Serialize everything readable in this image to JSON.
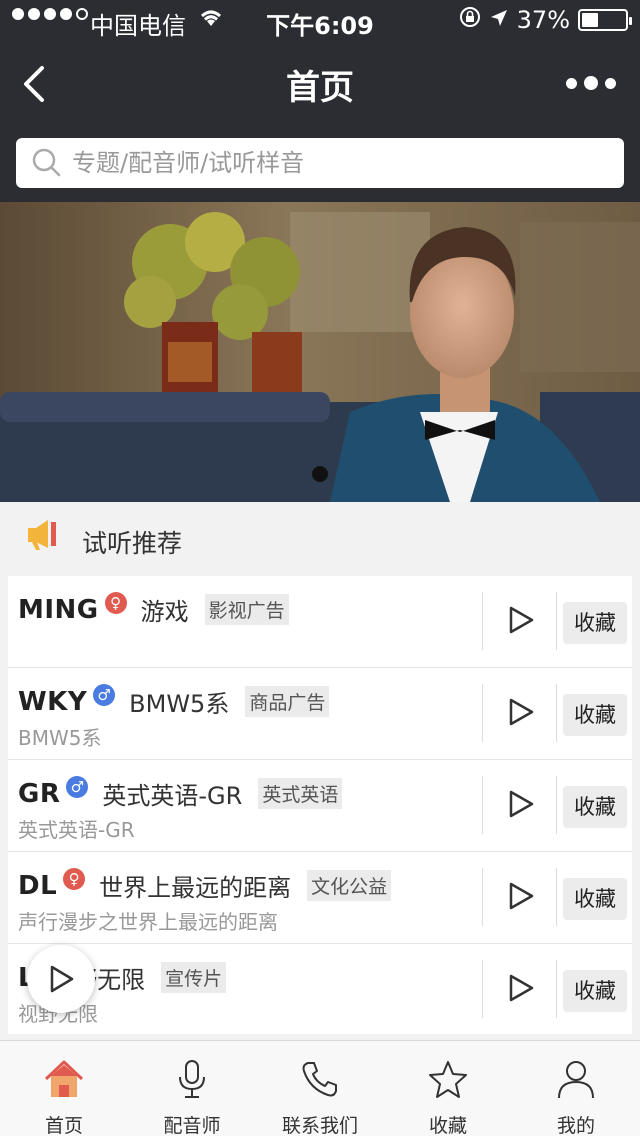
{
  "status": {
    "carrier": "中国电信",
    "time": "下午6:09",
    "battery": "37%",
    "battery_level": 0.37
  },
  "nav": {
    "title": "首页"
  },
  "search": {
    "placeholder": "专题/配音师/试听样音"
  },
  "section": {
    "title": "试听推荐"
  },
  "list": [
    {
      "name": "MING",
      "gender": "female",
      "work": "游戏",
      "tag": "影视广告",
      "subtitle": "",
      "fav": "收藏"
    },
    {
      "name": "WKY",
      "gender": "male",
      "work": "BMW5系",
      "tag": "商品广告",
      "subtitle": "BMW5系",
      "fav": "收藏"
    },
    {
      "name": "GR",
      "gender": "male",
      "work": "英式英语-GR",
      "tag": "英式英语",
      "subtitle": "英式英语-GR",
      "fav": "收藏"
    },
    {
      "name": "DL",
      "gender": "female",
      "work": "世界上最远的距离",
      "tag": "文化公益",
      "subtitle": "声行漫步之世界上最远的距离",
      "fav": "收藏"
    },
    {
      "name": "L",
      "gender": "",
      "work": "视野无限",
      "tag": "宣传片",
      "subtitle": "视野无限",
      "fav": "收藏"
    }
  ],
  "tabs": [
    {
      "label": "首页",
      "icon": "home-icon",
      "active": true
    },
    {
      "label": "配音师",
      "icon": "microphone-icon",
      "active": false
    },
    {
      "label": "联系我们",
      "icon": "phone-icon",
      "active": false
    },
    {
      "label": "收藏",
      "icon": "star-icon",
      "active": false
    },
    {
      "label": "我的",
      "icon": "user-icon",
      "active": false
    }
  ],
  "colors": {
    "nav_bg": "#2b2d33",
    "accent": "#e05a4f",
    "male": "#4a7be0"
  }
}
